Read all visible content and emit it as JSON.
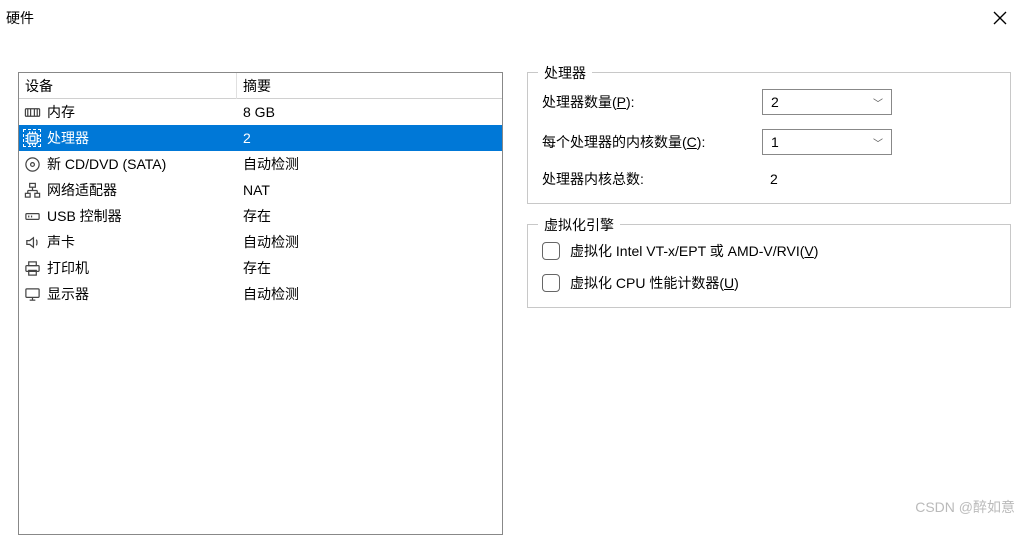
{
  "titlebar": {
    "title": "硬件"
  },
  "table": {
    "header_device": "设备",
    "header_summary": "摘要",
    "rows": [
      {
        "icon": "memory-icon",
        "label": "内存",
        "summary": "8 GB",
        "selected": false
      },
      {
        "icon": "cpu-icon",
        "label": "处理器",
        "summary": "2",
        "selected": true
      },
      {
        "icon": "disc-icon",
        "label": "新 CD/DVD (SATA)",
        "summary": "自动检测",
        "selected": false
      },
      {
        "icon": "network-icon",
        "label": "网络适配器",
        "summary": "NAT",
        "selected": false
      },
      {
        "icon": "usb-icon",
        "label": "USB 控制器",
        "summary": "存在",
        "selected": false
      },
      {
        "icon": "sound-icon",
        "label": "声卡",
        "summary": "自动检测",
        "selected": false
      },
      {
        "icon": "printer-icon",
        "label": "打印机",
        "summary": "存在",
        "selected": false
      },
      {
        "icon": "display-icon",
        "label": "显示器",
        "summary": "自动检测",
        "selected": false
      }
    ]
  },
  "processor_group": {
    "title": "处理器",
    "count_label_pre": "处理器数量(",
    "count_label_key": "P",
    "count_label_post": "):",
    "count_value": "2",
    "cores_label_pre": "每个处理器的内核数量(",
    "cores_label_key": "C",
    "cores_label_post": "):",
    "cores_value": "1",
    "total_label": "处理器内核总数:",
    "total_value": "2"
  },
  "virt_group": {
    "title": "虚拟化引擎",
    "opt1_pre": "虚拟化 Intel VT-x/EPT 或 AMD-V/RVI(",
    "opt1_key": "V",
    "opt1_post": ")",
    "opt2_pre": "虚拟化 CPU 性能计数器(",
    "opt2_key": "U",
    "opt2_post": ")"
  },
  "watermark": "CSDN @醉如意"
}
